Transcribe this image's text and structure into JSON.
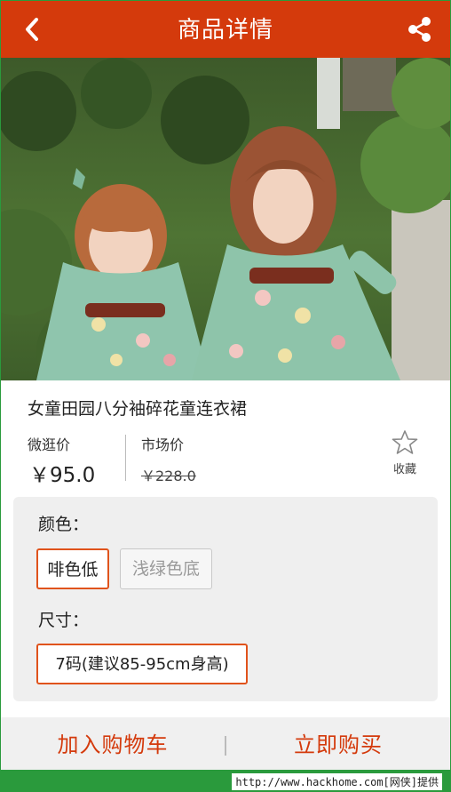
{
  "header": {
    "title": "商品详情",
    "back_icon": "chevron-left-icon",
    "share_icon": "share-icon"
  },
  "product": {
    "photo_alt": "",
    "name": "女童田园八分袖碎花童连衣裙",
    "micro_price_label": "微逛价",
    "micro_price": "￥95.0",
    "market_price_label": "市场价",
    "market_price": "￥228.0",
    "favorite_label": "收藏"
  },
  "options": {
    "color_label": "颜色：",
    "colors": [
      "啡色低",
      "浅绿色底"
    ],
    "size_label": "尺寸：",
    "size": "7码(建议85-95cm身高)"
  },
  "actions": {
    "add_to_cart": "加入购物车",
    "buy_now": "立即购买"
  },
  "watermark": "http://www.hackhome.com[网侠]提供",
  "colors": {
    "accent": "#d43a0c",
    "border_accent": "#e0531c",
    "frame": "#2a9a3c"
  }
}
